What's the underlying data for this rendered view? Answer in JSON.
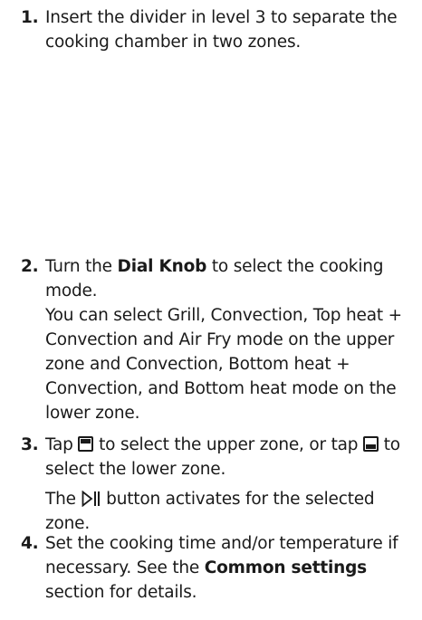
{
  "steps": [
    {
      "number": "1.",
      "text": "Insert the divider in level 3 to separate the cooking chamber in two zones."
    },
    {
      "number": "2.",
      "text_a": "Turn the ",
      "bold": "Dial Knob",
      "text_b": " to select the cooking mode.",
      "paragraph": "You can select Grill, Convection, Top heat + Convection and Air Fry mode on the upper zone and Convection, Bottom heat + Convection, and Bottom heat mode on the lower zone."
    },
    {
      "number": "3.",
      "text_a": "Tap ",
      "text_b": " to select the upper zone, or tap ",
      "text_c": " to select the lower zone.",
      "para_a": "The ",
      "para_b": " button activates for the selected zone.",
      "icons": [
        "upper-zone-icon",
        "lower-zone-icon",
        "start-pause-icon"
      ]
    },
    {
      "number": "4.",
      "text_a": "Set the cooking time and/or temperature if necessary. See the ",
      "bold": "Common settings",
      "text_b": " section for details."
    }
  ]
}
